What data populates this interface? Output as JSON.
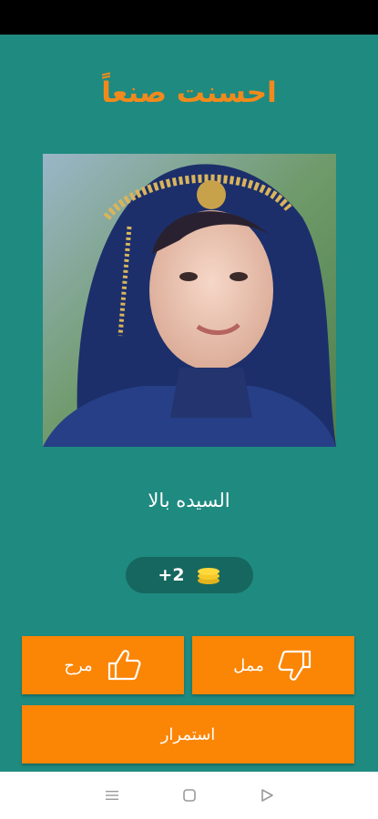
{
  "title": "احسنت صنعاً",
  "answer": "السيده بالا",
  "reward": {
    "text": "+2",
    "icon": "coins-icon"
  },
  "buttons": {
    "like_label": "مرح",
    "dislike_label": "ممل",
    "continue_label": "استمرار"
  },
  "colors": {
    "background": "#1f8a80",
    "accent": "#fb8505",
    "title": "#f08a1c",
    "pill": "#16675f"
  },
  "nav": [
    "menu-icon",
    "home-icon",
    "back-icon"
  ]
}
